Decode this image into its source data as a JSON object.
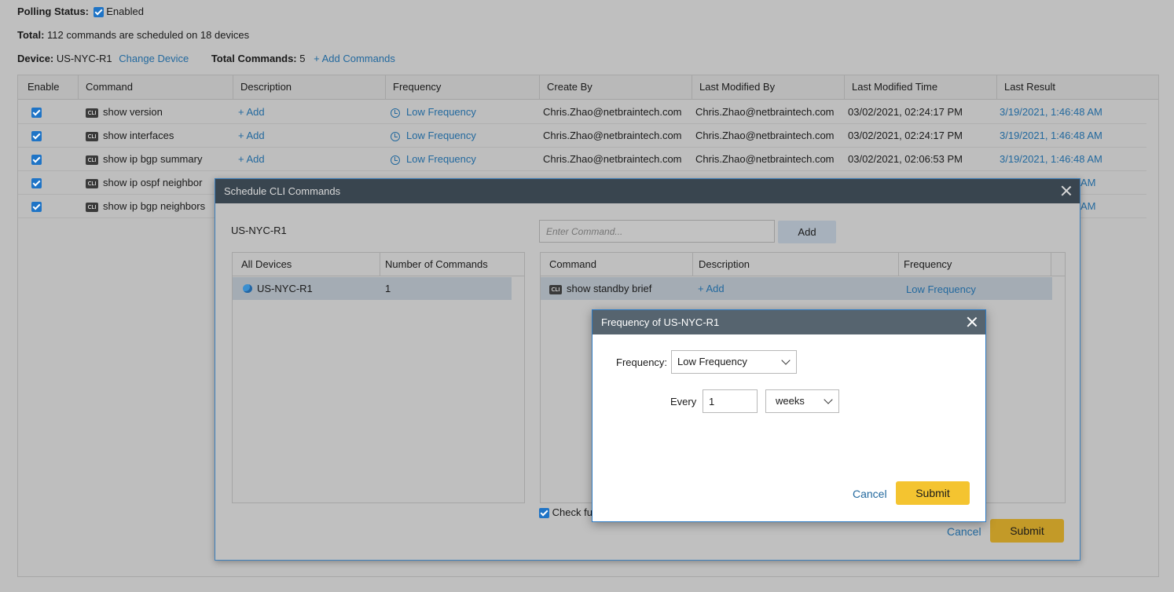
{
  "top": {
    "polling_label": "Polling Status:",
    "polling_value": "Enabled",
    "total_label": "Total:",
    "total_text": "112 commands are scheduled on 18 devices",
    "device_label": "Device:",
    "device_value": "US-NYC-R1",
    "change_device": "Change Device",
    "total_commands_label": "Total Commands:",
    "total_commands_value": "5",
    "add_commands": "+ Add Commands"
  },
  "grid": {
    "headers": [
      "Enable",
      "Command",
      "Description",
      "Frequency",
      "Create By",
      "Last Modified By",
      "Last Modified Time",
      "Last Result"
    ],
    "rows": [
      {
        "command": "show version",
        "description": "+ Add",
        "frequency": "Low Frequency",
        "create_by": "Chris.Zhao@netbraintech.com",
        "modified_by": "Chris.Zhao@netbraintech.com",
        "modified_time": "03/02/2021, 02:24:17 PM",
        "last_result": "3/19/2021, 1:46:48 AM"
      },
      {
        "command": "show interfaces",
        "description": "+ Add",
        "frequency": "Low Frequency",
        "create_by": "Chris.Zhao@netbraintech.com",
        "modified_by": "Chris.Zhao@netbraintech.com",
        "modified_time": "03/02/2021, 02:24:17 PM",
        "last_result": "3/19/2021, 1:46:48 AM"
      },
      {
        "command": "show ip bgp summary",
        "description": "+ Add",
        "frequency": "Low Frequency",
        "create_by": "Chris.Zhao@netbraintech.com",
        "modified_by": "Chris.Zhao@netbraintech.com",
        "modified_time": "03/02/2021, 02:06:53 PM",
        "last_result": "3/19/2021, 1:46:48 AM"
      },
      {
        "command": "show ip ospf neighbor",
        "last_result_tail": "AM"
      },
      {
        "command": "show ip bgp neighbors",
        "last_result_tail": "AM"
      }
    ],
    "cli_badge": "CLI"
  },
  "schedule_modal": {
    "title": "Schedule CLI Commands",
    "device_name": "US-NYC-R1",
    "command_placeholder": "Enter Command...",
    "add_button": "Add",
    "devices_headers": [
      "All Devices",
      "Number of Commands"
    ],
    "device_row": {
      "name": "US-NYC-R1",
      "count": "1"
    },
    "commands_headers": [
      "Command",
      "Description",
      "Frequency"
    ],
    "command_row": {
      "command": "show standby brief",
      "description": "+ Add",
      "frequency": "Low Frequency"
    },
    "check_label": "Check ful",
    "cancel": "Cancel",
    "submit": "Submit"
  },
  "freq_modal": {
    "title": "Frequency of US-NYC-R1",
    "frequency_label": "Frequency:",
    "frequency_value": "Low Frequency",
    "every_label": "Every",
    "every_value": "1",
    "unit_value": "weeks",
    "cancel": "Cancel",
    "submit": "Submit"
  }
}
